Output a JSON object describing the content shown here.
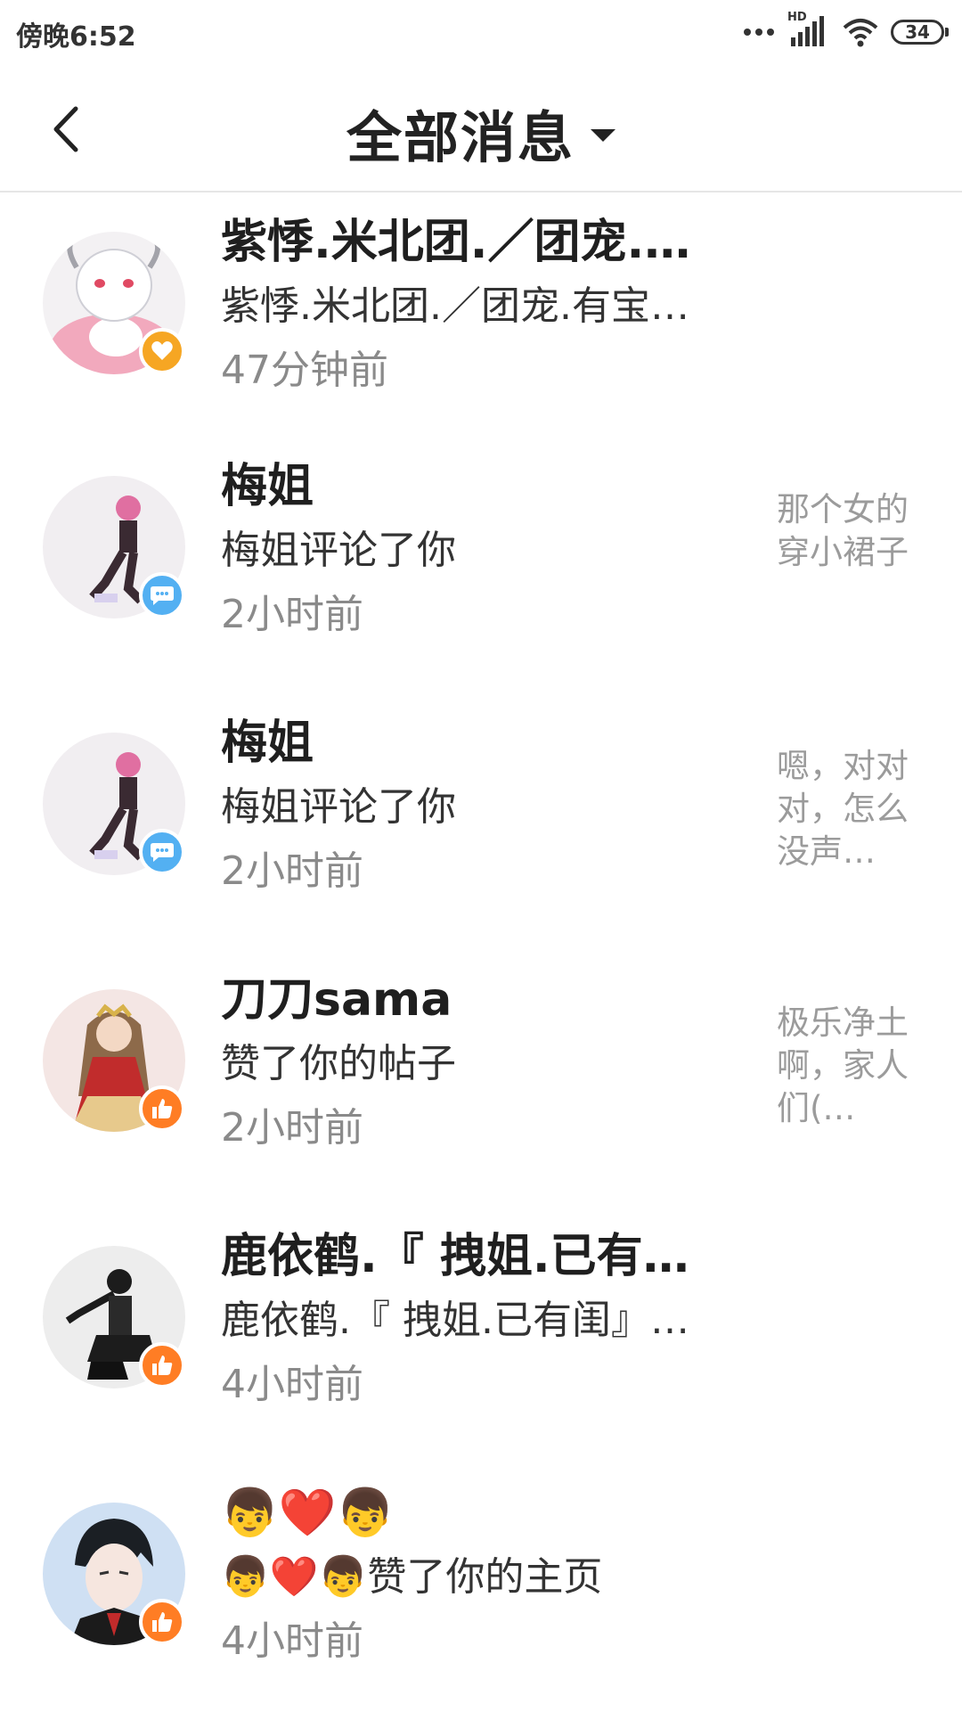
{
  "status": {
    "time": "傍晚6:52",
    "battery": "34",
    "hd": "HD"
  },
  "header": {
    "title": "全部消息"
  },
  "messages": [
    {
      "name": "紫悸.米北团.／团宠.…",
      "action": "紫悸.米北团.／团宠.有宝…",
      "time": "47分钟前",
      "snippet": "",
      "badge": "heart-icon"
    },
    {
      "name": "梅姐",
      "action": "梅姐评论了你",
      "time": "2小时前",
      "snippet": "那个女的穿小裙子",
      "badge": "comment-icon"
    },
    {
      "name": "梅姐",
      "action": "梅姐评论了你",
      "time": "2小时前",
      "snippet": "嗯，对对对，怎么没声…",
      "badge": "comment-icon"
    },
    {
      "name": "刀刀sama",
      "action": "赞了你的帖子",
      "time": "2小时前",
      "snippet": "极乐净土啊，家人们(…",
      "badge": "thumbs-up-icon"
    },
    {
      "name": "鹿依鹤.『 拽姐.已有…",
      "action": "鹿依鹤.『 拽姐.已有闺』…",
      "time": "4小时前",
      "snippet": "",
      "badge": "thumbs-up-icon"
    },
    {
      "name": "👦❤️👦",
      "action": "👦❤️👦赞了你的主页",
      "time": "4小时前",
      "snippet": "",
      "badge": "thumbs-up-icon"
    }
  ]
}
